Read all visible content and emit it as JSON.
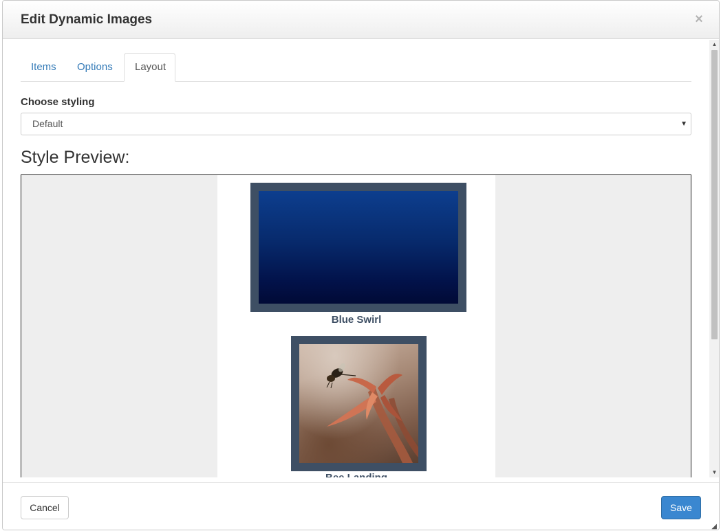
{
  "dialog": {
    "title": "Edit Dynamic Images",
    "close_symbol": "×"
  },
  "tabs": [
    {
      "label": "Items",
      "active": false
    },
    {
      "label": "Options",
      "active": false
    },
    {
      "label": "Layout",
      "active": true
    }
  ],
  "styling": {
    "label": "Choose styling",
    "selected": "Default",
    "arrow": "▼"
  },
  "preview": {
    "heading": "Style Preview:",
    "items": [
      {
        "caption": "Blue Swirl",
        "image": "blue-swirl-image"
      },
      {
        "caption": "Bee Landing",
        "image": "bee-landing-image"
      }
    ]
  },
  "footer": {
    "cancel_label": "Cancel",
    "save_label": "Save"
  },
  "scrollbar": {
    "up_arrow": "▲",
    "down_arrow": "▼"
  },
  "colors": {
    "link": "#337ab7",
    "primary": "#3a87d0",
    "frame": "#3e4f64",
    "preview_bg": "#eeeeee"
  }
}
